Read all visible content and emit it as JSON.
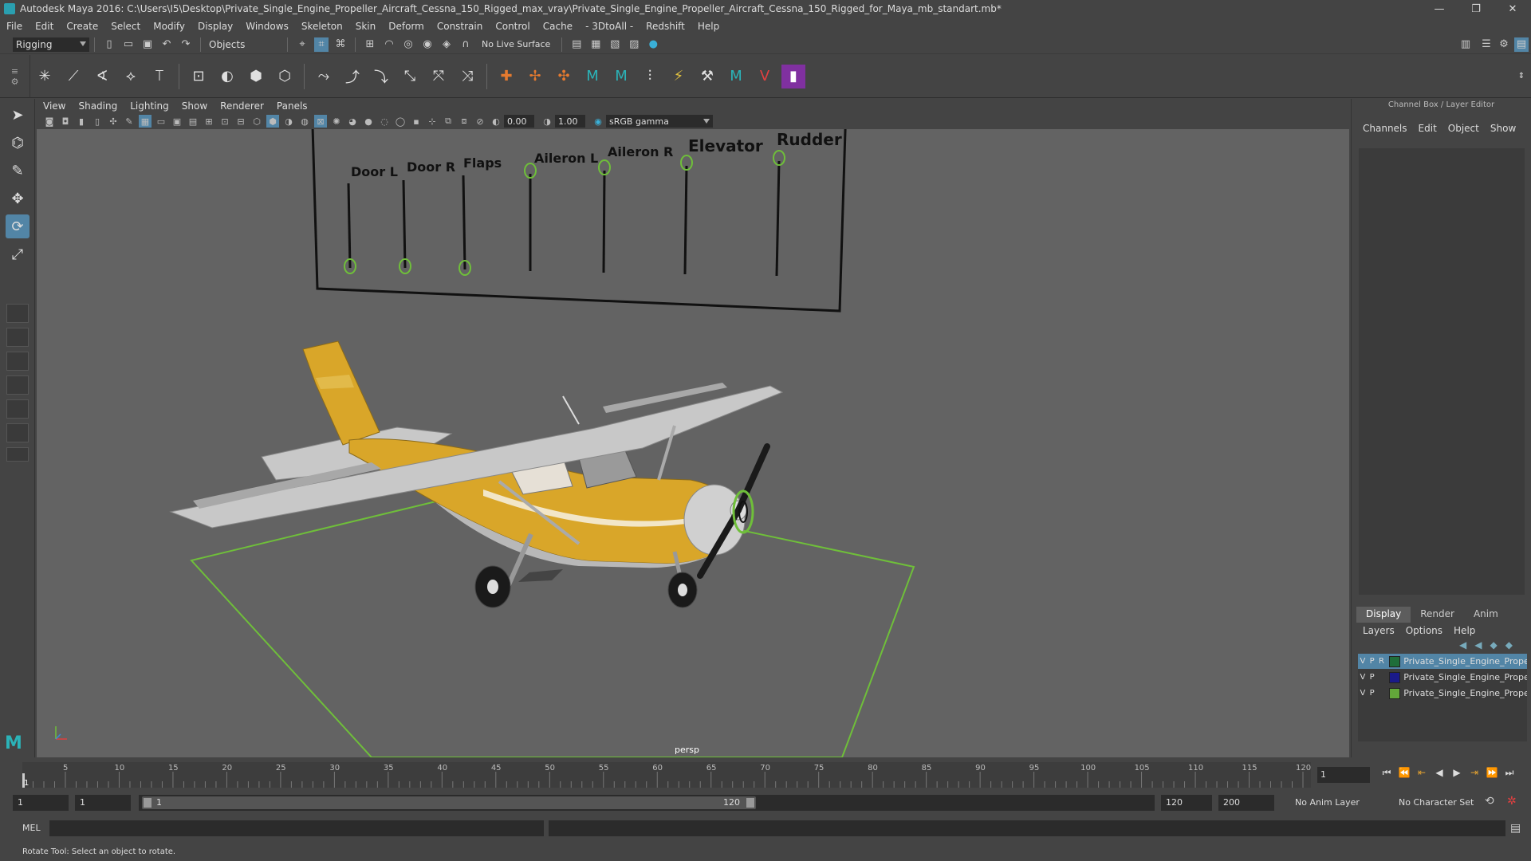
{
  "window": {
    "title": "Autodesk Maya 2016: C:\\Users\\I5\\Desktop\\Private_Single_Engine_Propeller_Aircraft_Cessna_150_Rigged_max_vray\\Private_Single_Engine_Propeller_Aircraft_Cessna_150_Rigged_for_Maya_mb_standart.mb*",
    "min": "—",
    "max": "❐",
    "close": "✕"
  },
  "menu": [
    "File",
    "Edit",
    "Create",
    "Select",
    "Modify",
    "Display",
    "Windows",
    "Skeleton",
    "Skin",
    "Deform",
    "Constrain",
    "Control",
    "Cache",
    "- 3DtoAll -",
    "Redshift",
    "Help"
  ],
  "status": {
    "mode": "Rigging",
    "selection_mode": "Objects",
    "live_surface": "No Live Surface"
  },
  "viewport": {
    "menu": [
      "View",
      "Shading",
      "Lighting",
      "Show",
      "Renderer",
      "Panels"
    ],
    "exposure": "0.00",
    "gamma": "1.00",
    "color_space": "sRGB gamma",
    "camera": "persp",
    "rig_labels": [
      "Door L",
      "Door R",
      "Flaps",
      "Aileron L",
      "Aileron R",
      "Elevator",
      "Rudder"
    ],
    "colors": {
      "bg": "#636363",
      "ctrl": "#6fbf3a",
      "fuselage": "#d9a629",
      "wing": "#c8c8c8"
    }
  },
  "channel_box": {
    "title": "Channel Box / Layer Editor",
    "menu": [
      "Channels",
      "Edit",
      "Object",
      "Show"
    ]
  },
  "layer_editor": {
    "tabs": [
      "Display",
      "Render",
      "Anim"
    ],
    "menu": [
      "Layers",
      "Options",
      "Help"
    ],
    "layers": [
      {
        "v": "V",
        "p": "P",
        "r": "R",
        "name": "Private_Single_Engine_Prope",
        "color": "#1f6e3a"
      },
      {
        "v": "V",
        "p": "P",
        "r": "",
        "name": "Private_Single_Engine_Prope",
        "color": "#1a1a8a"
      },
      {
        "v": "V",
        "p": "P",
        "r": "",
        "name": "Private_Single_Engine_Prope",
        "color": "#63a83a"
      }
    ]
  },
  "timeline": {
    "ticks": [
      "5",
      "10",
      "15",
      "20",
      "25",
      "30",
      "35",
      "40",
      "45",
      "50",
      "55",
      "60",
      "65",
      "70",
      "75",
      "80",
      "85",
      "90",
      "95",
      "100",
      "105",
      "110",
      "115",
      "120"
    ],
    "current_frame": "1",
    "start_marker": "1"
  },
  "range": {
    "start": "1",
    "anim_start": "1",
    "handle_start": "1",
    "handle_end": "120",
    "range_end": "120",
    "anim_end": "200",
    "anim_layer": "No Anim Layer",
    "char_set": "No Character Set"
  },
  "cmd": {
    "label": "MEL"
  },
  "help": {
    "text": "Rotate Tool: Select an object to rotate."
  }
}
